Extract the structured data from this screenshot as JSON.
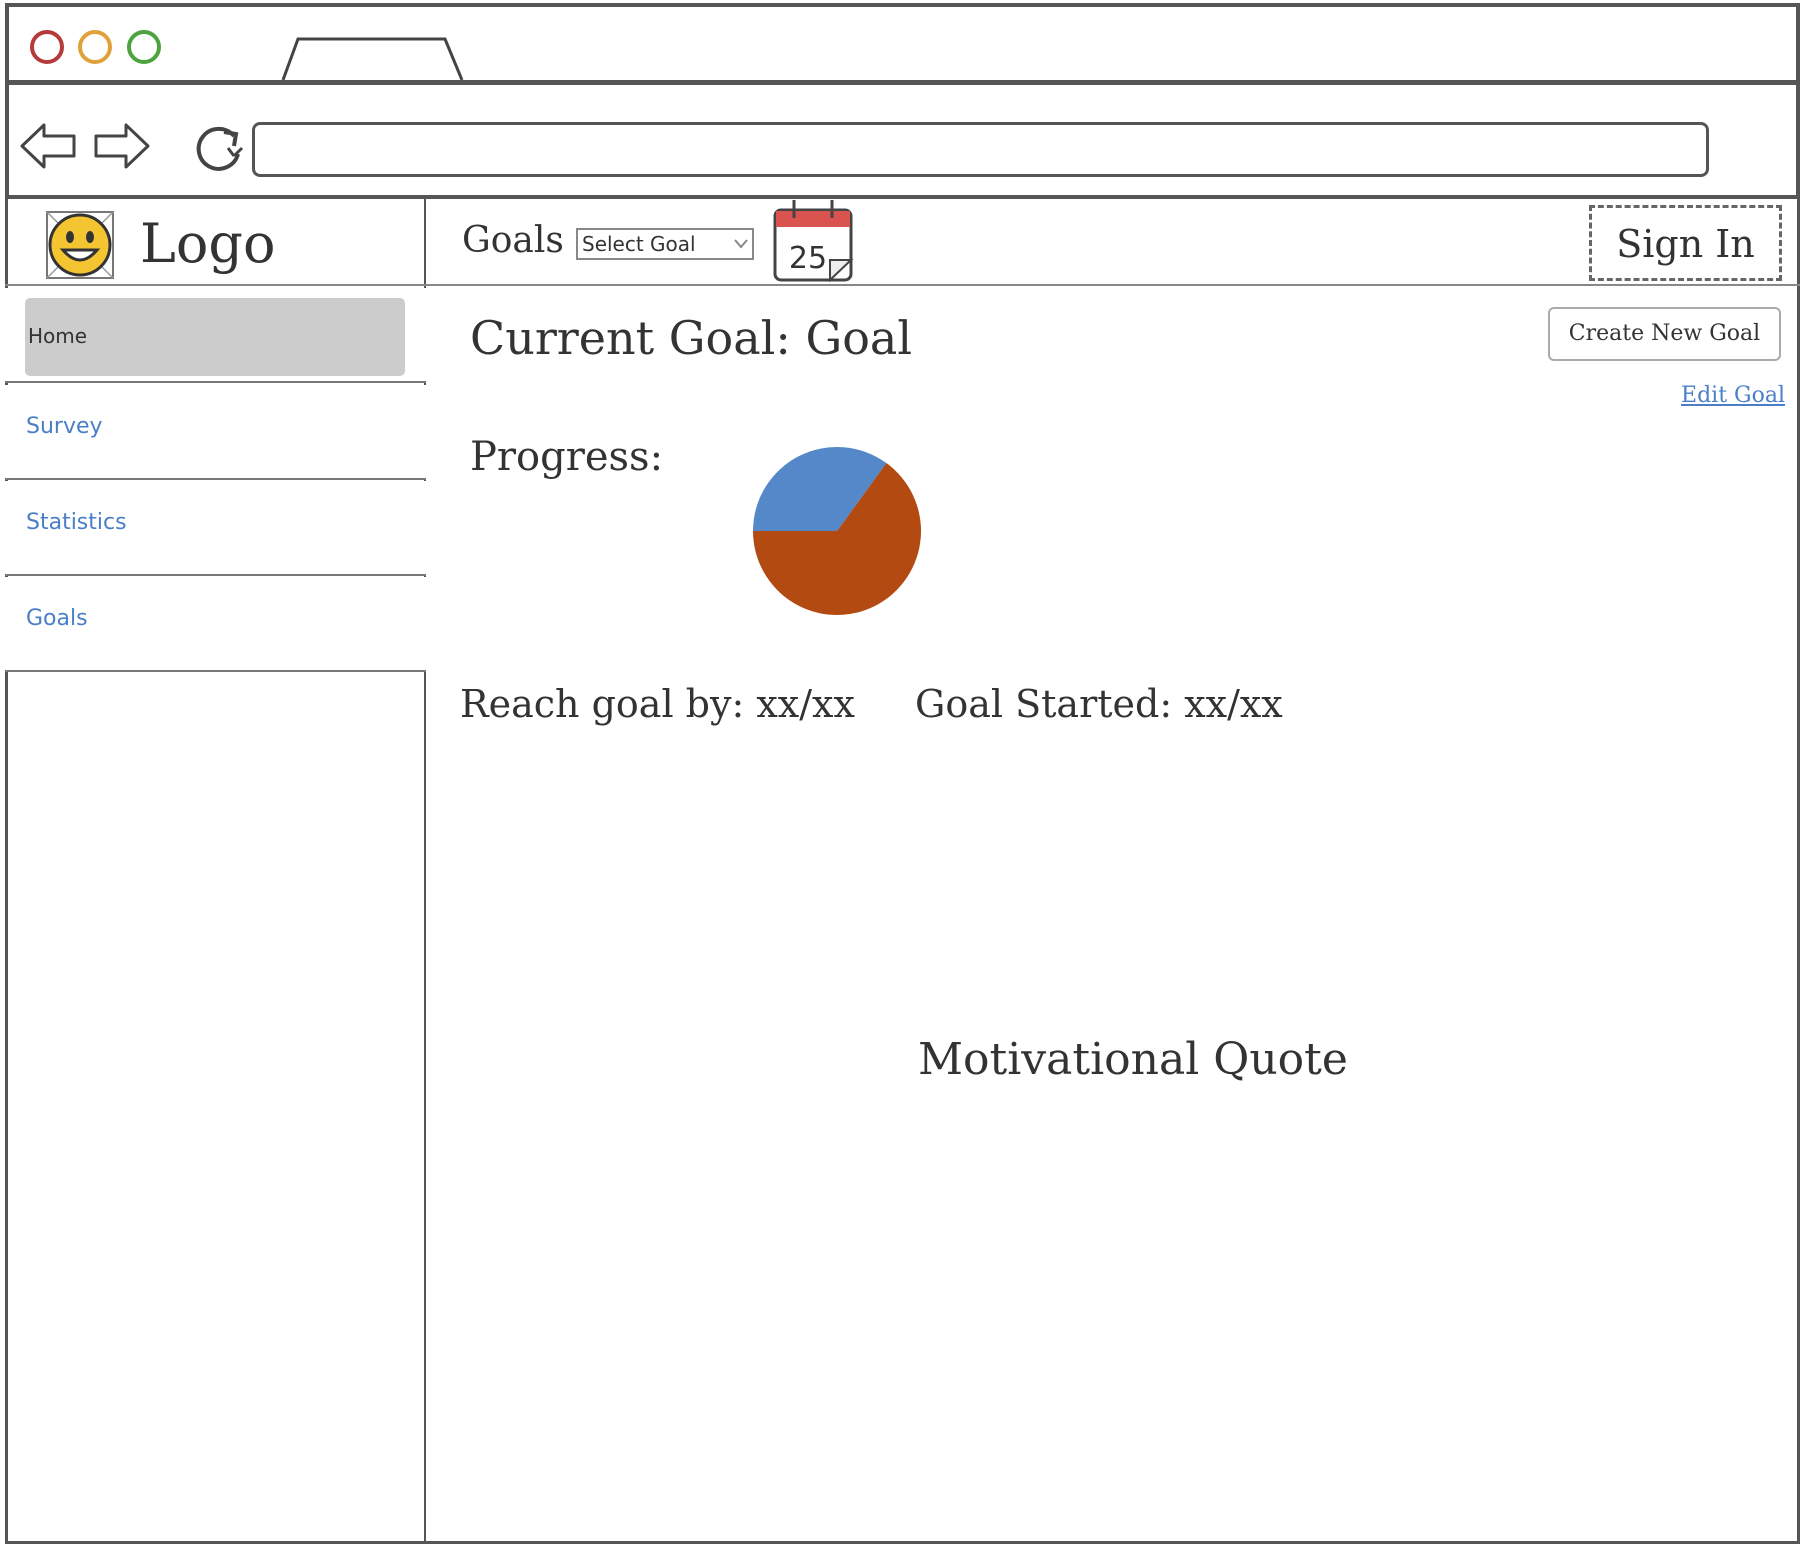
{
  "sidebar": {
    "logo_text": "Logo",
    "items": [
      {
        "label": "Home"
      },
      {
        "label": "Survey"
      },
      {
        "label": "Statistics"
      },
      {
        "label": "Goals"
      }
    ]
  },
  "header": {
    "goals_label": "Goals",
    "select_goal": "Select Goal",
    "calendar_day": "25",
    "sign_in": "Sign In"
  },
  "main": {
    "current_goal": "Current Goal: Goal",
    "create_new_goal": "Create New Goal",
    "edit_goal": "Edit Goal",
    "progress_label": "Progress:",
    "reach_goal_by": "Reach goal by: xx/xx",
    "goal_started": "Goal Started: xx/xx",
    "quote": "Motivational Quote"
  },
  "progress": {
    "complete_fraction": 0.35,
    "complete_color": "#5588c9",
    "remaining_color": "#b24a12"
  },
  "colors": {
    "dot_close": "#b53b3b",
    "dot_minimize": "#e1a13a",
    "dot_maximize": "#4fa33f",
    "link": "#4a7fc8"
  }
}
